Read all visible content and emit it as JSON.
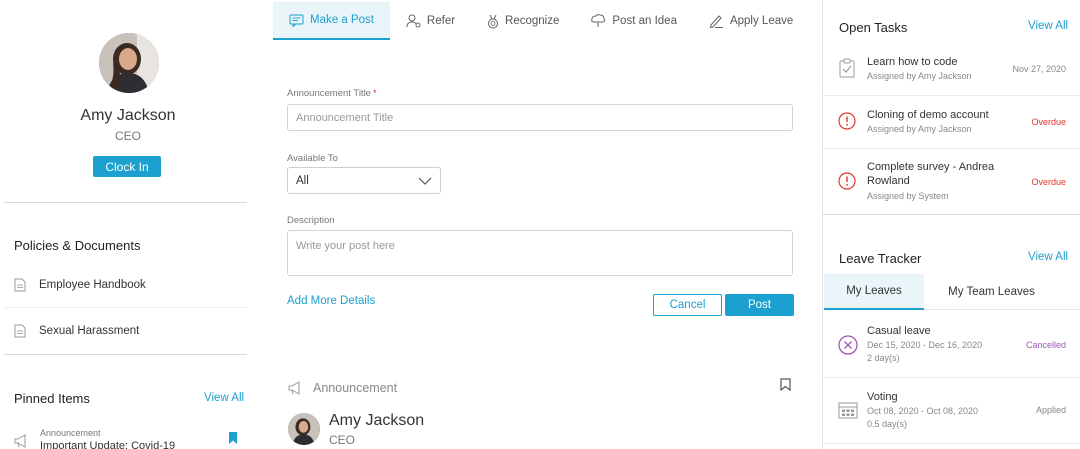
{
  "profile": {
    "name": "Amy Jackson",
    "role": "CEO",
    "clock_in_label": "Clock In"
  },
  "policies": {
    "title": "Policies & Documents",
    "items": [
      {
        "label": "Employee Handbook",
        "icon": "document-icon"
      },
      {
        "label": "Sexual Harassment",
        "icon": "document-icon"
      }
    ]
  },
  "pinned": {
    "title": "Pinned Items",
    "view_all": "View All",
    "items": [
      {
        "type": "Announcement",
        "title": "Important Update: Covid-19"
      }
    ]
  },
  "composer": {
    "tabs": [
      {
        "label": "Make a Post",
        "icon": "post-icon",
        "active": true
      },
      {
        "label": "Refer",
        "icon": "refer-icon",
        "active": false
      },
      {
        "label": "Recognize",
        "icon": "medal-icon",
        "active": false
      },
      {
        "label": "Post an Idea",
        "icon": "idea-icon",
        "active": false
      },
      {
        "label": "Apply Leave",
        "icon": "pen-icon",
        "active": false
      }
    ],
    "title_label": "Announcement Title",
    "required_mark": "*",
    "title_placeholder": "Announcement Title",
    "available_label": "Available To",
    "available_value": "All",
    "description_label": "Description",
    "description_placeholder": "Write your post here",
    "more_details": "Add More Details",
    "cancel_label": "Cancel",
    "post_label": "Post"
  },
  "feed": {
    "post_type": "Announcement",
    "author_name": "Amy Jackson",
    "author_role": "CEO"
  },
  "open_tasks": {
    "title": "Open Tasks",
    "view_all": "View All",
    "items": [
      {
        "title": "Learn how to code",
        "assigned": "Assigned by Amy Jackson",
        "meta": "Nov 27, 2020",
        "icon": "clipboard-check-icon"
      },
      {
        "title": "Cloning of demo account",
        "assigned": "Assigned by Amy Jackson",
        "meta": "Overdue",
        "icon": "alert-circle-icon"
      },
      {
        "title": "Complete survey - Andrea Rowland",
        "assigned": "Assigned by System",
        "meta": "Overdue",
        "icon": "alert-circle-icon"
      }
    ]
  },
  "leave_tracker": {
    "title": "Leave Tracker",
    "view_all": "View All",
    "tabs": [
      {
        "label": "My Leaves",
        "active": true
      },
      {
        "label": "My Team Leaves",
        "active": false
      }
    ],
    "items": [
      {
        "title": "Casual leave",
        "dates": "Dec 15, 2020 - Dec 16, 2020",
        "days": "2 day(s)",
        "status": "Cancelled",
        "icon": "cancel-circle-icon"
      },
      {
        "title": "Voting",
        "dates": "Oct 08, 2020 - Oct 08, 2020",
        "days": "0.5 day(s)",
        "status": "Applied",
        "icon": "calendar-icon"
      }
    ]
  },
  "colors": {
    "accent": "#1ba0cf",
    "overdue": "#e0352b",
    "cancelled": "#9b59b6",
    "applied": "#888888"
  }
}
